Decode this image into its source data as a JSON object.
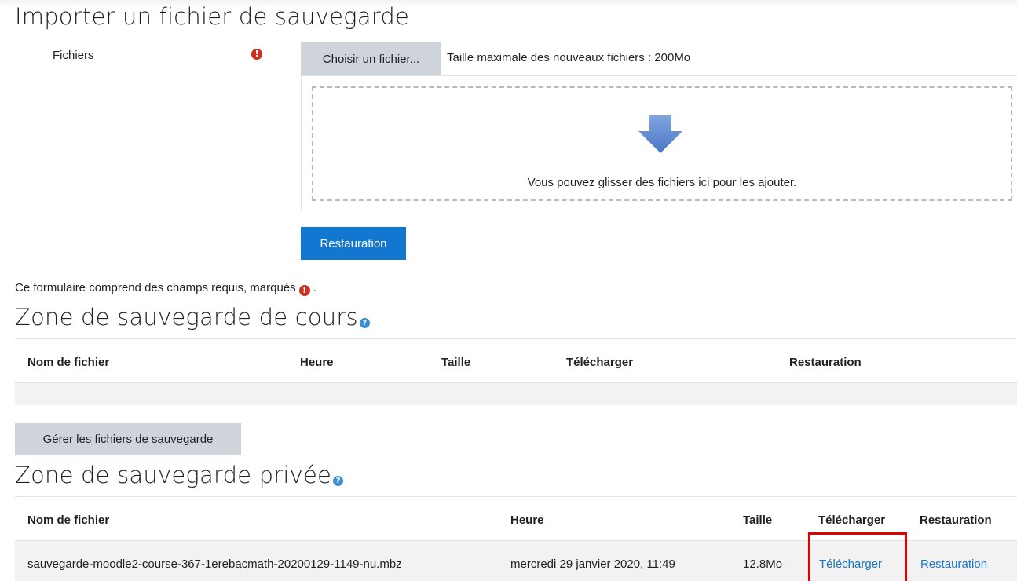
{
  "page": {
    "title": "Importer un fichier de sauvegarde"
  },
  "upload": {
    "files_label": "Fichiers",
    "required_icon": "exclamation-circle-icon",
    "choose_button": "Choisir un fichier...",
    "max_size": "Taille maximale des nouveaux fichiers : 200Mo",
    "drop_text": "Vous pouvez glisser des fichiers ici pour les ajouter.",
    "drop_icon": "down-arrow-icon",
    "restore_button": "Restauration"
  },
  "form_note": {
    "text": "Ce formulaire comprend des champs requis, marqués",
    "suffix": "."
  },
  "course_zone": {
    "title": "Zone de sauvegarde de cours",
    "help_icon": "question-circle-icon",
    "headers": [
      "Nom de fichier",
      "Heure",
      "Taille",
      "Télécharger",
      "Restauration"
    ],
    "manage_button": "Gérer les fichiers de sauvegarde"
  },
  "private_zone": {
    "title": "Zone de sauvegarde privée",
    "help_icon": "question-circle-icon",
    "headers": [
      "Nom de fichier",
      "Heure",
      "Taille",
      "Télécharger",
      "Restauration"
    ],
    "rows": [
      {
        "filename": "sauvegarde-moodle2-course-367-1erebacmath-20200129-1149-nu.mbz",
        "time": "mercredi 29 janvier 2020, 11:49",
        "size": "12.8Mo",
        "download": "Télécharger",
        "restore": "Restauration"
      }
    ]
  },
  "colors": {
    "primary": "#1177d1",
    "required": "#ca3120",
    "highlight": "#e00000",
    "secondary_button": "#ced4da"
  }
}
